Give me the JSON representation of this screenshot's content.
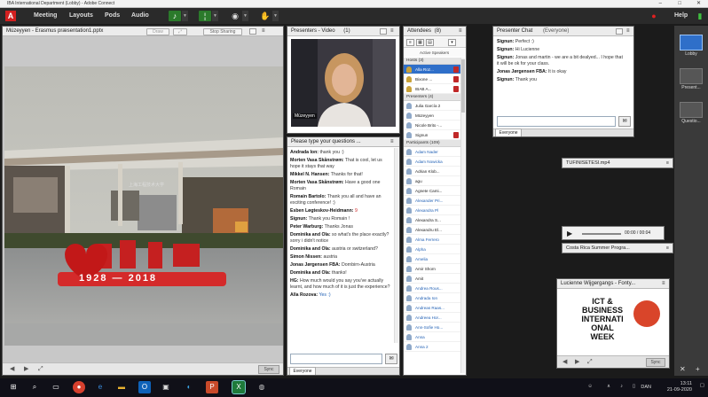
{
  "window": {
    "title": "IBA International Department (Lobby) - Adobe Connect"
  },
  "menubar": {
    "logo": "A",
    "menus": [
      "Meeting",
      "Layouts",
      "Pods",
      "Audio"
    ],
    "help": "Help"
  },
  "share_pod": {
    "title": "Müzeyyen - Erasmus præsentation1.pptx",
    "draw_label": "Draw",
    "stop_label": "Stop Sharing",
    "sync_label": "Sync",
    "slide": {
      "banner_text": "上海工程技术大学",
      "chars": "九十",
      "years": "1928 — 2018"
    }
  },
  "video_pod": {
    "title": "Presenters - Video",
    "count": "(1)",
    "name_tag": "Müzeyyen"
  },
  "chat_pod": {
    "title": "Please type your questions ...",
    "tab": "Everyone",
    "messages": [
      {
        "name": "Andrada Ion:",
        "text": "thank you :)",
        "style": "normal"
      },
      {
        "name": "Morten Vasa Skånstrøm:",
        "text": "That is cool, let us hope it stays that way",
        "style": "normal"
      },
      {
        "name": "Mikkel N. Hansen:",
        "text": "Thanks for that!",
        "style": "normal"
      },
      {
        "name": "Morten Vasa Skånstrøm:",
        "text": "Have a good one Romain",
        "style": "normal"
      },
      {
        "name": "Romain Bartolo:",
        "text": "Thank you all and have an exciting conference! :)",
        "style": "normal"
      },
      {
        "name": "Esben Løgteskov-Heidmann:",
        "text": "9",
        "style": "red"
      },
      {
        "name": "Signun:",
        "text": "Thank you Romain !",
        "style": "normal"
      },
      {
        "name": "Peter Warburg:",
        "text": "Thanks Jonas",
        "style": "normal"
      },
      {
        "name": "Dominika and Ola:",
        "text": "so what's the place exactly? sorry i didn't notice",
        "style": "normal"
      },
      {
        "name": "Dominika and Ola:",
        "text": "austria or switzerland?",
        "style": "normal"
      },
      {
        "name": "Simon Nissen:",
        "text": "austria",
        "style": "normal"
      },
      {
        "name": "Jonas Jørgensen FBA:",
        "text": "Dornbirn-Austria",
        "style": "normal"
      },
      {
        "name": "Dominika and Ola:",
        "text": "thanks!",
        "style": "normal"
      },
      {
        "name": "HG:",
        "text": "How much would you say you've actually learnt, and how much of it is just the experience?",
        "style": "normal"
      },
      {
        "name": "Alla Rozova:",
        "text": "Yes :)",
        "style": "blue"
      }
    ]
  },
  "attendees_pod": {
    "title": "Attendees",
    "count": "(8)",
    "status": "Active Speakers",
    "groups": [
      {
        "label": "Hosts (3)",
        "rows": [
          {
            "name": "Alla Roz...",
            "kind": "host",
            "selected": true,
            "status": true
          },
          {
            "name": "Bixone ...",
            "kind": "host",
            "selected": false,
            "status": true
          },
          {
            "name": "IBAB A...",
            "kind": "host",
            "selected": false,
            "status": true
          }
        ]
      },
      {
        "label": "Presenters (4)",
        "rows": [
          {
            "name": "Julia García 2",
            "kind": "dark",
            "selected": false,
            "status": false
          },
          {
            "name": "Müzeyyen",
            "kind": "dark",
            "selected": false,
            "status": false
          },
          {
            "name": "Nicole Brito -...",
            "kind": "dark",
            "selected": false,
            "status": false
          },
          {
            "name": "Signun",
            "kind": "dark",
            "selected": false,
            "status": true
          }
        ]
      },
      {
        "label": "Participants (109)",
        "rows": [
          {
            "name": "Adam Nader",
            "kind": "part"
          },
          {
            "name": "Adam Nowicka",
            "kind": "part"
          },
          {
            "name": "Adrian Klob...",
            "kind": "dark"
          },
          {
            "name": "agu",
            "kind": "dark"
          },
          {
            "name": "Agnete Cami...",
            "kind": "dark"
          },
          {
            "name": "Alexander Pri...",
            "kind": "part"
          },
          {
            "name": "Alexandra Pl",
            "kind": "part"
          },
          {
            "name": "Alexandra S...",
            "kind": "dark"
          },
          {
            "name": "Alexandru El...",
            "kind": "dark"
          },
          {
            "name": "Alma Ferrero",
            "kind": "part"
          },
          {
            "name": "Alpha",
            "kind": "part"
          },
          {
            "name": "Amelia",
            "kind": "part"
          },
          {
            "name": "Amir Shorn",
            "kind": "dark"
          },
          {
            "name": "Amit",
            "kind": "dark"
          },
          {
            "name": "Andrea Rous...",
            "kind": "part"
          },
          {
            "name": "Andrada Ion",
            "kind": "part"
          },
          {
            "name": "Andreas Raas...",
            "kind": "part"
          },
          {
            "name": "Andreea Hor...",
            "kind": "part"
          },
          {
            "name": "Ann-Sofie Ho...",
            "kind": "part"
          },
          {
            "name": "Anna",
            "kind": "part"
          },
          {
            "name": "Anna 2",
            "kind": "part"
          }
        ]
      }
    ]
  },
  "presenter_chat": {
    "title": "Presenter Chat",
    "audience": "(Everyone)",
    "tab": "Everyone",
    "messages": [
      {
        "name": "Signun:",
        "text": "Perfect :)"
      },
      {
        "name": "Signun:",
        "text": "Hi Lucienne"
      },
      {
        "name": "Signun:",
        "text": "Jonas and martin - we are a bit dealyed... I hope that it will be ok for your class."
      },
      {
        "name": "Jonas Jørgensen FBA:",
        "text": "It is okay"
      },
      {
        "name": "Signun:",
        "text": "Thank you"
      }
    ]
  },
  "files": {
    "video_file": "TUFINISETESI.mp4",
    "time": "00:00 / 00:04",
    "costa_rica": "Costa Rica Summer Progra..."
  },
  "ict_pod": {
    "title": "Lucienne Wijgergangs - Fonty...",
    "lines": [
      "ICT &",
      "BUSINESS",
      "INTERNATI",
      "ONAL",
      "WEEK"
    ],
    "sync_label": "Sync"
  },
  "layouts_panel": {
    "items": [
      "Lobby",
      "Present...",
      "Questio..."
    ]
  },
  "taskbar": {
    "lang": "DAN",
    "time": "13:11",
    "date": "21-09-2020"
  },
  "colors": {
    "accent": "#2f6fc9",
    "adobe_red": "#d32020",
    "host_gold": "#c9a23a"
  }
}
